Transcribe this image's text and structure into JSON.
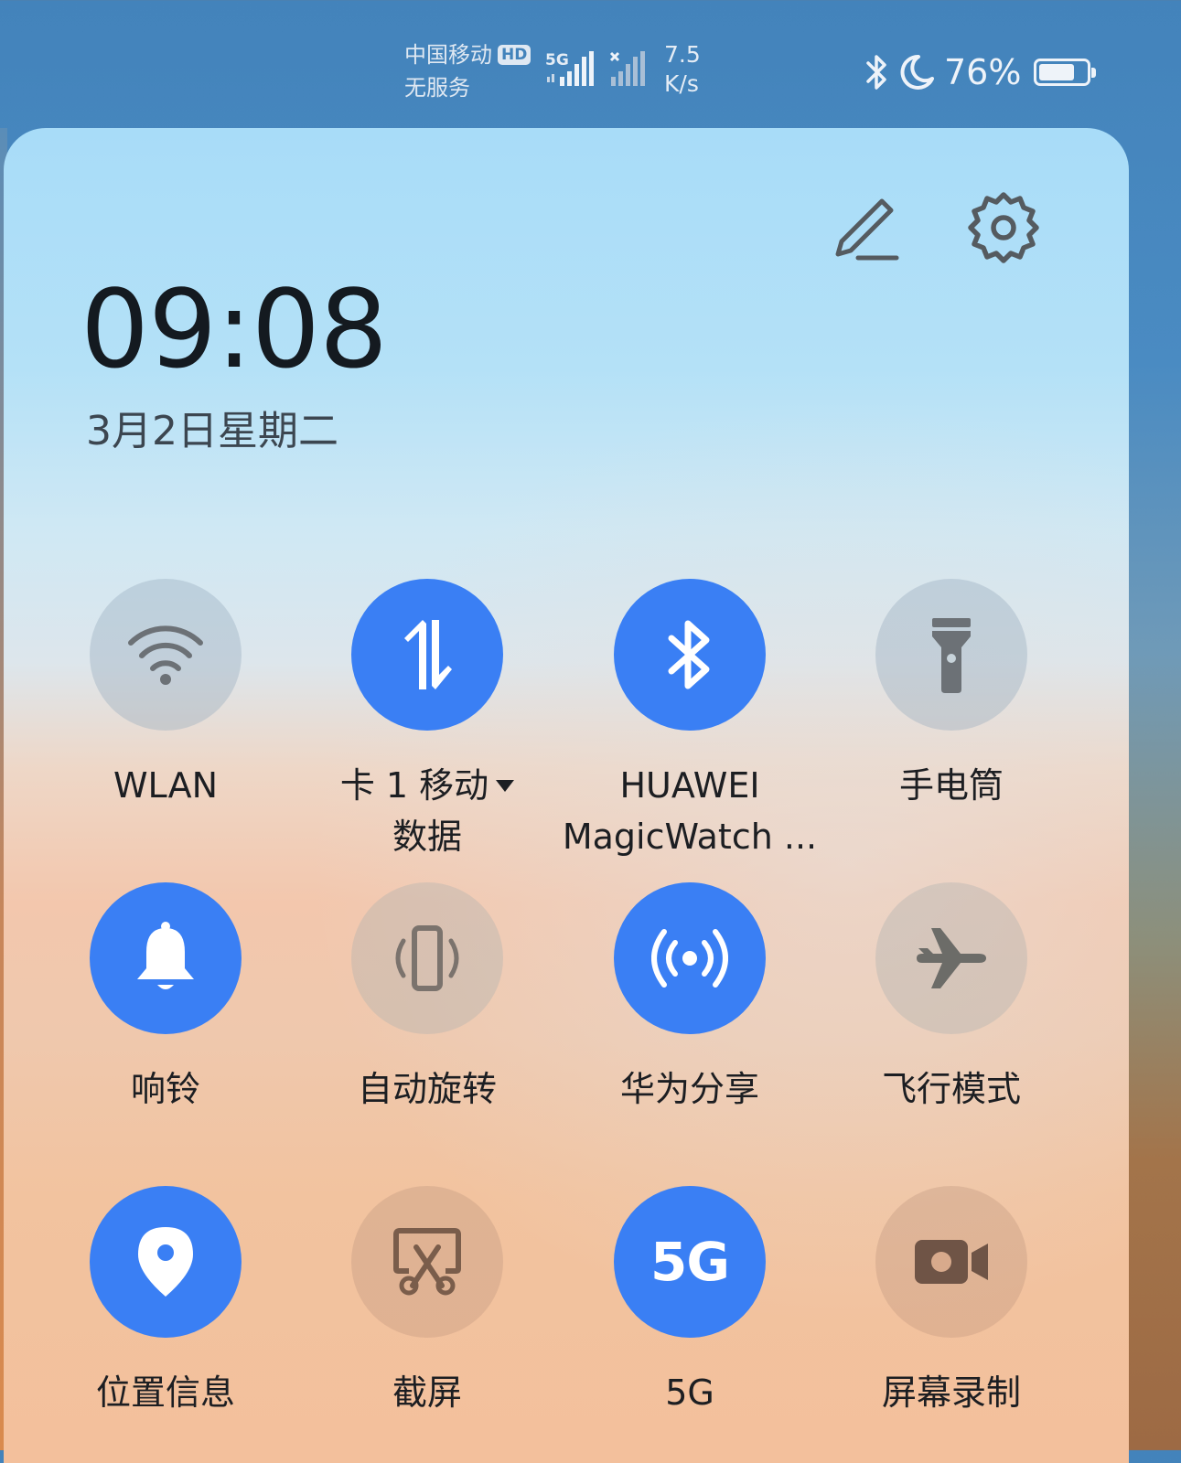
{
  "status_bar": {
    "carrier_name": "中国移动",
    "carrier_badge": "HD",
    "carrier_status": "无服务",
    "network_label": "5G",
    "net_speed_value": "7.5",
    "net_speed_unit": "K/s",
    "battery_percent_text": "76%",
    "battery_level": 0.76,
    "icons": [
      "bluetooth-icon",
      "moon-icon",
      "battery-icon"
    ]
  },
  "panel": {
    "time": "09:08",
    "date": "3月2日星期二",
    "edit_icon": "pencil-icon",
    "settings_icon": "gear-icon"
  },
  "tiles": [
    {
      "label": "WLAN",
      "icon": "wifi-icon",
      "state": "off"
    },
    {
      "label": "卡 1 移动",
      "label2": "数据",
      "icon": "data-transfer-icon",
      "state": "on"
    },
    {
      "label": "HUAWEI",
      "label2": "MagicWatch ...",
      "icon": "bluetooth-icon",
      "state": "on"
    },
    {
      "label": "手电筒",
      "icon": "flashlight-icon",
      "state": "off"
    },
    {
      "label": "响铃",
      "icon": "bell-icon",
      "state": "on"
    },
    {
      "label": "自动旋转",
      "icon": "auto-rotate-icon",
      "state": "off"
    },
    {
      "label": "华为分享",
      "icon": "huawei-share-icon",
      "state": "on"
    },
    {
      "label": "飞行模式",
      "icon": "airplane-icon",
      "state": "off"
    },
    {
      "label": "位置信息",
      "icon": "location-icon",
      "state": "on"
    },
    {
      "label": "截屏",
      "icon": "screenshot-icon",
      "state": "off"
    },
    {
      "label": "5G",
      "icon_text": "5G",
      "icon": "5g-icon",
      "state": "on"
    },
    {
      "label": "屏幕录制",
      "icon": "screen-record-icon",
      "state": "off"
    }
  ],
  "colors": {
    "active_tile": "#3a7ff4",
    "status_bar_bg": "#4383bb"
  }
}
